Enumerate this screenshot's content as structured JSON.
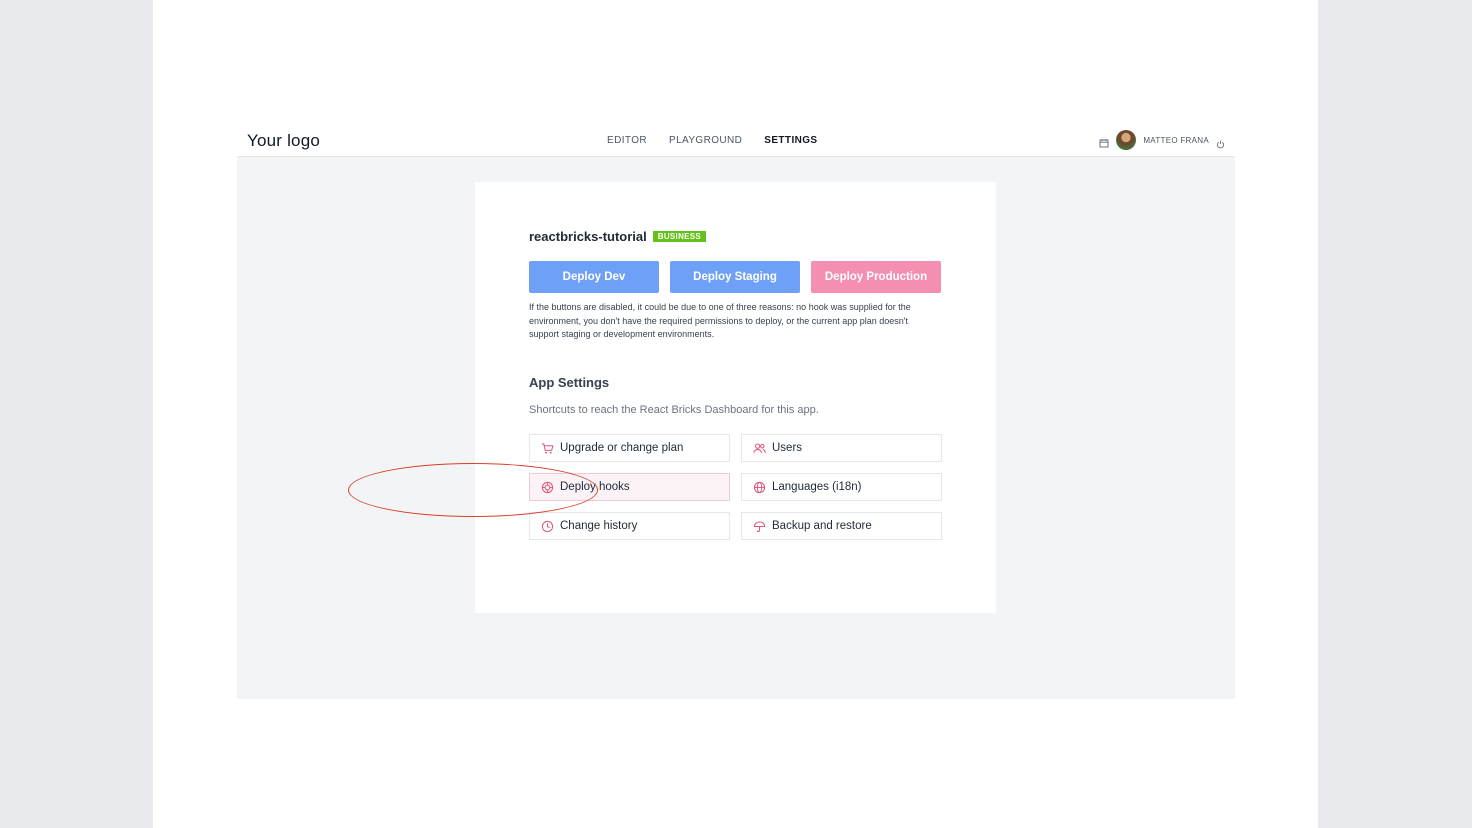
{
  "header": {
    "logo": "Your logo",
    "nav": [
      "EDITOR",
      "PLAYGROUND",
      "SETTINGS"
    ],
    "active_nav": "SETTINGS",
    "user_name": "MATTEO FRANA"
  },
  "project": {
    "name": "reactbricks-tutorial",
    "plan_badge": "BUSINESS"
  },
  "deploy": {
    "buttons": [
      "Deploy Dev",
      "Deploy Staging",
      "Deploy Production"
    ],
    "note": "If the buttons are disabled, it could be due to one of three reasons: no hook was supplied for the environment, you don't have the required permissions to deploy, or the current app plan doesn't support staging or development environments."
  },
  "app_settings": {
    "title": "App Settings",
    "subtitle": "Shortcuts to reach the React Bricks Dashboard for this app.",
    "shortcuts": [
      {
        "label": "Upgrade or change plan",
        "icon": "cart-icon"
      },
      {
        "label": "Users",
        "icon": "users-icon"
      },
      {
        "label": "Deploy hooks",
        "icon": "hook-icon"
      },
      {
        "label": "Languages (i18n)",
        "icon": "globe-icon"
      },
      {
        "label": "Change history",
        "icon": "clock-icon"
      },
      {
        "label": "Backup and restore",
        "icon": "umbrella-icon"
      }
    ]
  },
  "colors": {
    "deploy_blue": "#6fa0f7",
    "deploy_pink": "#f48fb1",
    "badge_green": "#65c01c",
    "icon_pink": "#e0557a",
    "highlight_ring": "#d7402b"
  }
}
